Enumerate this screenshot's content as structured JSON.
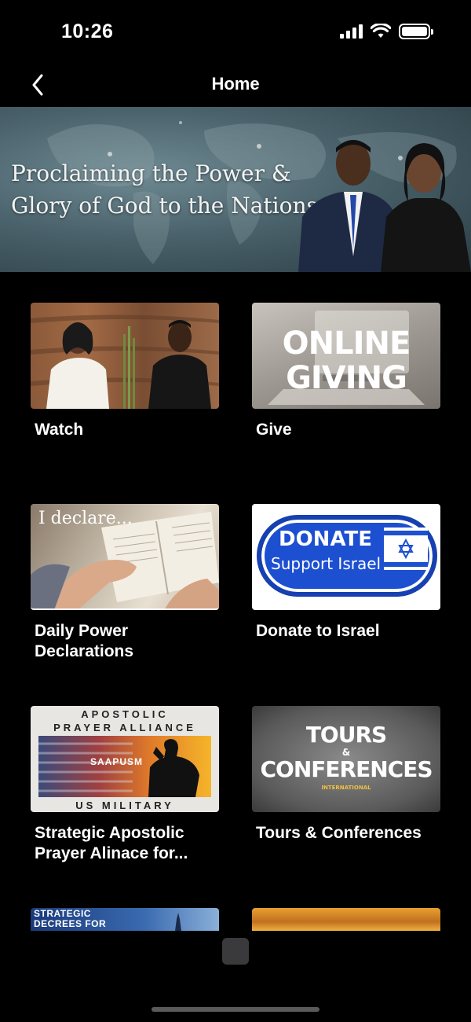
{
  "status_bar": {
    "time": "10:26"
  },
  "nav": {
    "title": "Home",
    "back_icon": "chevron-left-icon"
  },
  "banner": {
    "line1": "Proclaiming the Power &",
    "line2": "Glory of God to the Nations"
  },
  "tiles": [
    {
      "label": "Watch"
    },
    {
      "label": "Give",
      "image_text": [
        "ONLINE",
        "GIVING"
      ]
    },
    {
      "label": "Daily Power\nDeclarations",
      "image_text": "I declare..."
    },
    {
      "label": "Donate to Israel",
      "image_text": [
        "DONATE",
        "Support Israel"
      ]
    },
    {
      "label": "Strategic Apostolic\nPrayer Alinace for...",
      "image_text": [
        "APOSTOLIC",
        "PRAYER ALLIANCE",
        "SAAPUSM",
        "US MILITARY"
      ]
    },
    {
      "label": "Tours & Conferences",
      "image_text": [
        "TOURS",
        "&",
        "CONFERENCES",
        "INTERNATIONAL"
      ]
    },
    {
      "label": "",
      "image_text": [
        "STRATEGIC",
        "DECREES FOR"
      ]
    },
    {
      "label": ""
    }
  ],
  "colors": {
    "background": "#000000",
    "text": "#ffffff",
    "donate_blue": "#1d4fd1"
  }
}
